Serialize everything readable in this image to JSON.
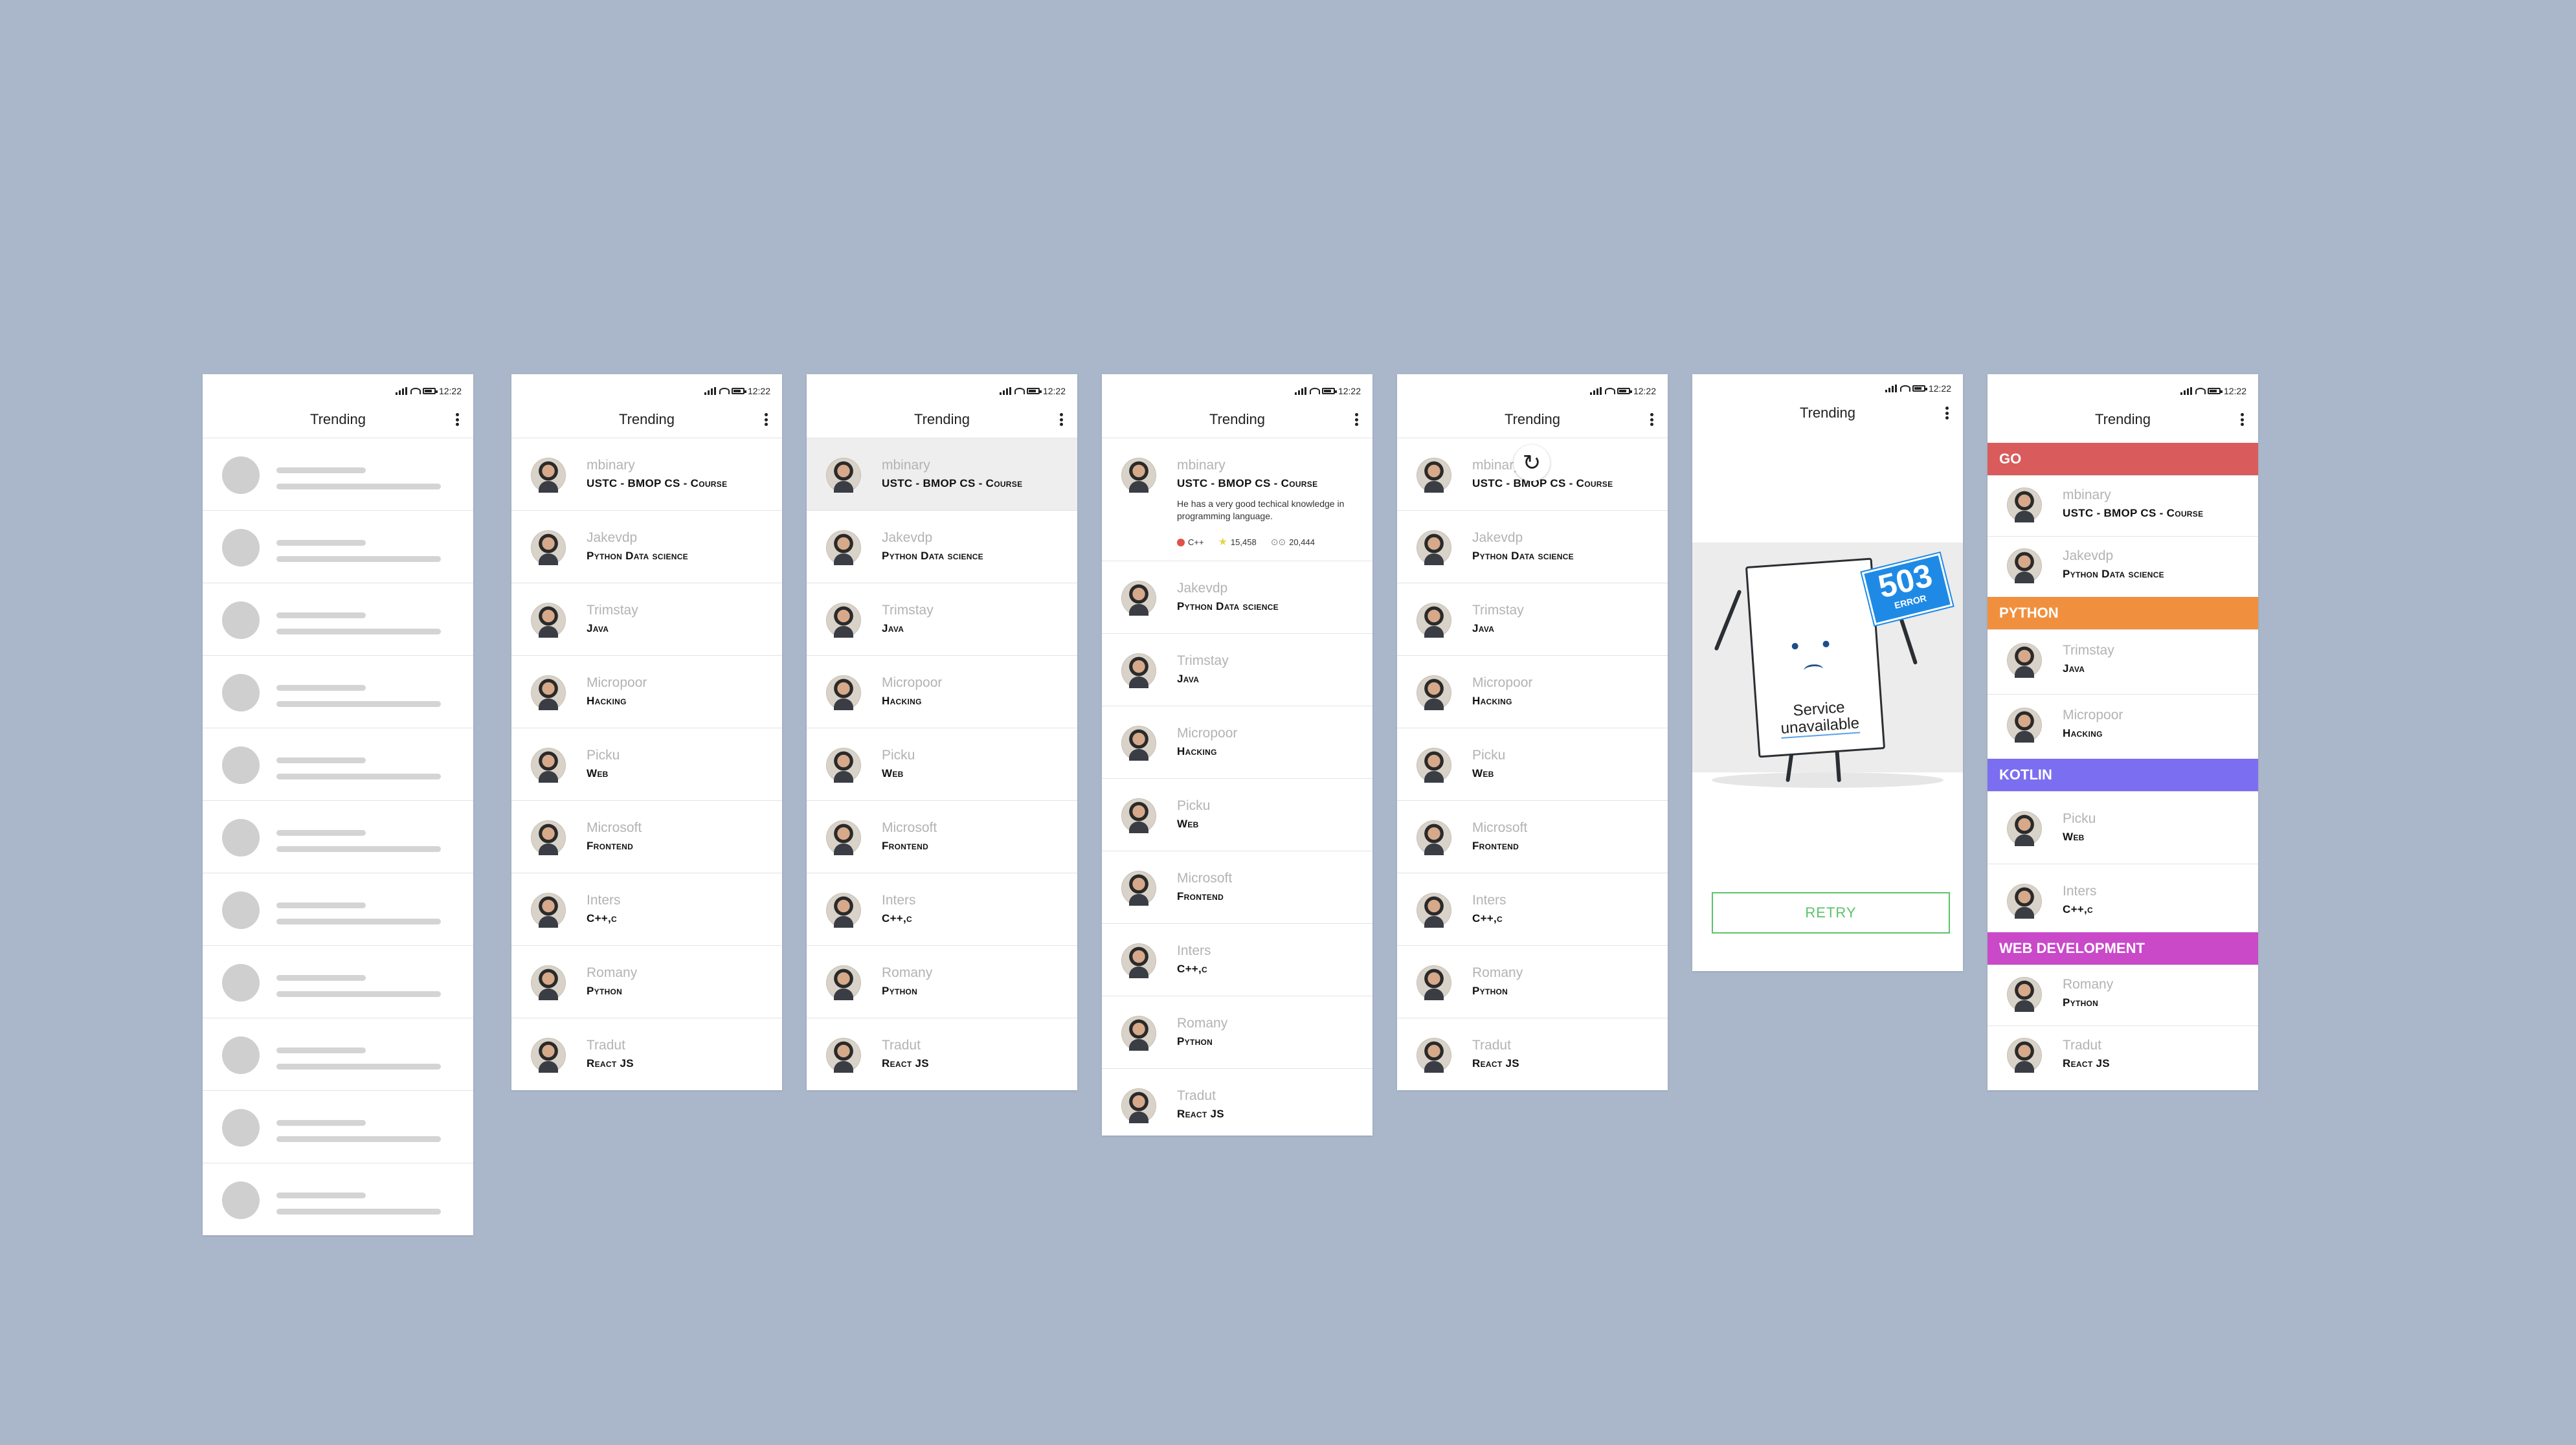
{
  "colors": {
    "board_bg": "#aab7ca",
    "section_go": "#d95b5b",
    "section_python": "#f0903f",
    "section_kotlin": "#7c6ef0",
    "section_web": "#c949c9",
    "error_sign": "#1f8ae6",
    "retry": "#5cc26a"
  },
  "status_time": "12:22",
  "title": "Trending",
  "repos": [
    {
      "user": "mbinary",
      "desc": "USTC - BMOP CS - Course"
    },
    {
      "user": "Jakevdp",
      "desc": "Python Data science"
    },
    {
      "user": "Trimstay",
      "desc": "Java"
    },
    {
      "user": "Micropoor",
      "desc": "Hacking"
    },
    {
      "user": "Picku",
      "desc": "Web"
    },
    {
      "user": "Microsoft",
      "desc": "Frontend"
    },
    {
      "user": "Inters",
      "desc": "C++,c"
    },
    {
      "user": "Romany",
      "desc": "Python"
    },
    {
      "user": "Tradut",
      "desc": "React JS"
    }
  ],
  "expanded": {
    "detail": "He has a very good techical knowledge in programming language.",
    "language": "C++",
    "stars": "15,458",
    "forks": "20,444"
  },
  "error": {
    "code": "503",
    "label": "ERROR",
    "line1": "Service",
    "line2": "unavailable",
    "retry": "RETRY"
  },
  "sections": {
    "go": "GO",
    "python": "PYTHON",
    "kotlin": "KOTLIN",
    "web": "WEB DEVELOPMENT"
  }
}
